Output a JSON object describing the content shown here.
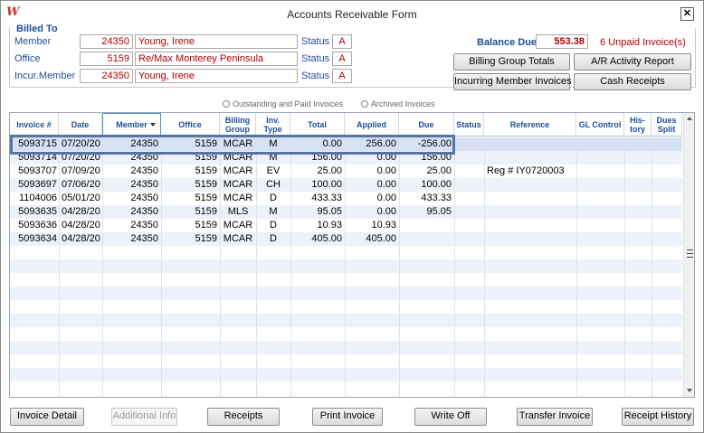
{
  "window": {
    "title": "Accounts Receivable Form",
    "app_icon": "W"
  },
  "billed_to": {
    "title": "Billed To",
    "member": {
      "label": "Member",
      "id": "24350",
      "name": "Young, Irene",
      "status_label": "Status",
      "status": "A"
    },
    "office": {
      "label": "Office",
      "id": "5159",
      "name": "Re/Max Monterey Peninsula",
      "status_label": "Status",
      "status": "A"
    },
    "incur_member": {
      "label": "Incur.Member",
      "id": "24350",
      "name": "Young, Irene",
      "status_label": "Status",
      "status": "A"
    }
  },
  "balance": {
    "label": "Balance Due",
    "value": "553.38",
    "unpaid_count": "6",
    "unpaid_label": "Unpaid Invoice(s)"
  },
  "action_buttons": {
    "billing_group_totals": "Billing Group Totals",
    "ar_activity_report": "A/R Activity Report",
    "incurring_member_invoices": "Incurring Member Invoices",
    "cash_receipts": "Cash Receipts"
  },
  "filter": {
    "outstanding": "Outstanding and Paid Invoices",
    "archived": "Archived Invoices"
  },
  "grid": {
    "columns": {
      "invoice": "Invoice #",
      "date": "Date",
      "member": "Member",
      "office": "Office",
      "billing_group": "Billing Group",
      "inv_type": "Inv. Type",
      "total": "Total",
      "applied": "Applied",
      "due": "Due",
      "status": "Status",
      "reference": "Reference",
      "gl_control": "GL Control",
      "history": "His-tory",
      "dues_split": "Dues Split"
    },
    "rows": [
      {
        "invoice": "5093715",
        "date": "07/20/20",
        "member": "24350",
        "office": "5159",
        "billing_group": "MCAR",
        "inv_type": "M",
        "total": "0.00",
        "applied": "256.00",
        "due": "-256.00",
        "status": "",
        "reference": "",
        "gl_control": "",
        "history": "",
        "dues_split": ""
      },
      {
        "invoice": "5093714",
        "date": "07/20/20",
        "member": "24350",
        "office": "5159",
        "billing_group": "MCAR",
        "inv_type": "M",
        "total": "156.00",
        "applied": "0.00",
        "due": "156.00",
        "status": "",
        "reference": "",
        "gl_control": "",
        "history": "",
        "dues_split": ""
      },
      {
        "invoice": "5093707",
        "date": "07/09/20",
        "member": "24350",
        "office": "5159",
        "billing_group": "MCAR",
        "inv_type": "EV",
        "total": "25.00",
        "applied": "0.00",
        "due": "25.00",
        "status": "",
        "reference": "Reg # IY0720003",
        "gl_control": "",
        "history": "",
        "dues_split": ""
      },
      {
        "invoice": "5093697",
        "date": "07/06/20",
        "member": "24350",
        "office": "5159",
        "billing_group": "MCAR",
        "inv_type": "CH",
        "total": "100.00",
        "applied": "0.00",
        "due": "100.00",
        "status": "",
        "reference": "",
        "gl_control": "",
        "history": "",
        "dues_split": ""
      },
      {
        "invoice": "1104006",
        "date": "05/01/20",
        "member": "24350",
        "office": "5159",
        "billing_group": "MCAR",
        "inv_type": "D",
        "total": "433.33",
        "applied": "0.00",
        "due": "433.33",
        "status": "",
        "reference": "",
        "gl_control": "",
        "history": "",
        "dues_split": ""
      },
      {
        "invoice": "5093635",
        "date": "04/28/20",
        "member": "24350",
        "office": "5159",
        "billing_group": "MLS",
        "inv_type": "M",
        "total": "95.05",
        "applied": "0.00",
        "due": "95.05",
        "status": "",
        "reference": "",
        "gl_control": "",
        "history": "",
        "dues_split": ""
      },
      {
        "invoice": "5093636",
        "date": "04/28/20",
        "member": "24350",
        "office": "5159",
        "billing_group": "MCAR",
        "inv_type": "D",
        "total": "10.93",
        "applied": "10.93",
        "due": "",
        "status": "",
        "reference": "",
        "gl_control": "",
        "history": "",
        "dues_split": ""
      },
      {
        "invoice": "5093634",
        "date": "04/28/20",
        "member": "24350",
        "office": "5159",
        "billing_group": "MCAR",
        "inv_type": "D",
        "total": "405.00",
        "applied": "405.00",
        "due": "",
        "status": "",
        "reference": "",
        "gl_control": "",
        "history": "",
        "dues_split": ""
      }
    ]
  },
  "bottom_buttons": {
    "invoice_detail": "Invoice Detail",
    "additional_info": "Additional Info",
    "receipts": "Receipts",
    "print_invoice": "Print Invoice",
    "write_off": "Write Off",
    "transfer_invoice": "Transfer Invoice",
    "receipt_history": "Receipt History"
  },
  "colors": {
    "label_blue": "#1f4e99",
    "value_red": "#b00000",
    "selection_border": "#5275a3",
    "alt_row": "#edf2fa"
  },
  "icons": {
    "close": "close-icon",
    "sort": "sort-down-icon"
  }
}
